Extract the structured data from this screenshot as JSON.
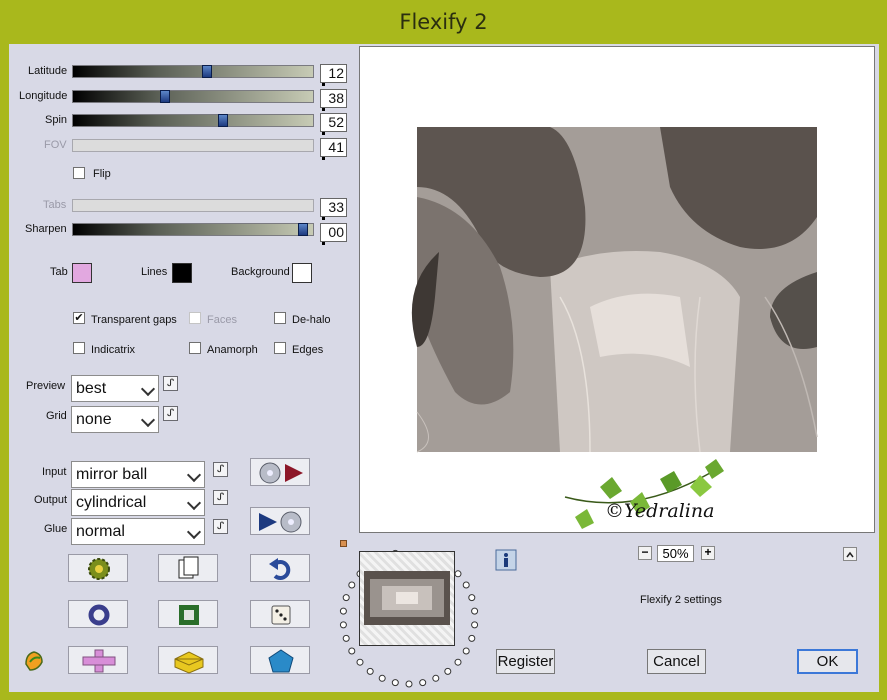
{
  "window": {
    "title": "Flexify 2"
  },
  "sliders": {
    "latitude": {
      "label": "Latitude",
      "value": "12",
      "pos": 0.56
    },
    "longitude": {
      "label": "Longitude",
      "value": "38",
      "pos": 0.38
    },
    "spin": {
      "label": "Spin",
      "value": "52",
      "pos": 0.63
    },
    "fov": {
      "label": "FOV",
      "value": "41",
      "pos": 0.0
    },
    "tabs": {
      "label": "Tabs",
      "value": "33",
      "pos": 0.0
    },
    "sharpen": {
      "label": "Sharpen",
      "value": "00",
      "pos": 0.98
    }
  },
  "flip": {
    "label": "Flip",
    "checked": false
  },
  "colors": {
    "tab": {
      "label": "Tab",
      "hex": "#e2a8e0"
    },
    "lines": {
      "label": "Lines",
      "hex": "#000000"
    },
    "background": {
      "label": "Background",
      "hex": "#ffffff"
    }
  },
  "options": {
    "transparent_gaps": {
      "label": "Transparent gaps",
      "checked": true
    },
    "faces": {
      "label": "Faces",
      "checked": false
    },
    "de_halo": {
      "label": "De-halo",
      "checked": false
    },
    "indicatrix": {
      "label": "Indicatrix",
      "checked": false
    },
    "anamorph": {
      "label": "Anamorph",
      "checked": false
    },
    "edges": {
      "label": "Edges",
      "checked": false
    }
  },
  "selects": {
    "preview": {
      "label": "Preview",
      "value": "best"
    },
    "grid": {
      "label": "Grid",
      "value": "none"
    },
    "input": {
      "label": "Input",
      "value": "mirror ball"
    },
    "output": {
      "label": "Output",
      "value": "cylindrical"
    },
    "glue": {
      "label": "Glue",
      "value": "normal"
    }
  },
  "preview_panel": {
    "watermark": "©Yedralina"
  },
  "zoom": {
    "value": "50%"
  },
  "status_text": "Flexify 2 settings",
  "buttons": {
    "register": "Register",
    "cancel": "Cancel",
    "ok": "OK"
  },
  "palette": {
    "accent": "#a9b81c",
    "panel": "#d8d9e6",
    "ok_border": "#3c78d8"
  }
}
